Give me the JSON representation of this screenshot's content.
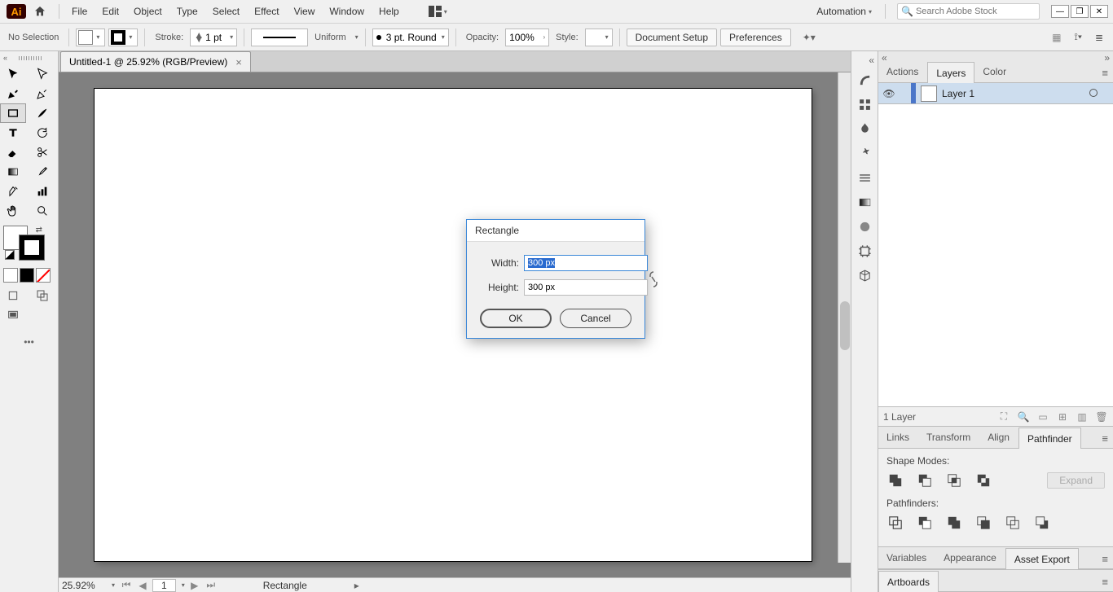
{
  "menu": {
    "items": [
      "File",
      "Edit",
      "Object",
      "Type",
      "Select",
      "Effect",
      "View",
      "Window",
      "Help"
    ]
  },
  "workspace": "Automation",
  "search_placeholder": "Search Adobe Stock",
  "control": {
    "selection": "No Selection",
    "stroke_label": "Stroke:",
    "stroke_weight": "1 pt",
    "brush_label": "Uniform",
    "vw_label": "3 pt. Round",
    "opacity_label": "Opacity:",
    "opacity_value": "100%",
    "style_label": "Style:",
    "doc_setup": "Document Setup",
    "prefs": "Preferences"
  },
  "doc_tab": {
    "title": "Untitled-1 @ 25.92% (RGB/Preview)"
  },
  "dialog": {
    "title": "Rectangle",
    "width_label": "Width:",
    "width_value": "300 px",
    "height_label": "Height:",
    "height_value": "300 px",
    "ok": "OK",
    "cancel": "Cancel"
  },
  "rpanel": {
    "tabs1": [
      "Actions",
      "Layers",
      "Color"
    ],
    "layer_name": "Layer 1",
    "layer_count": "1 Layer",
    "tabs2": [
      "Links",
      "Transform",
      "Align",
      "Pathfinder"
    ],
    "shape_modes": "Shape Modes:",
    "expand": "Expand",
    "pathfinders": "Pathfinders:",
    "tabs3": [
      "Variables",
      "Appearance",
      "Asset Export"
    ],
    "tabs4": [
      "Artboards"
    ]
  },
  "status": {
    "zoom": "25.92%",
    "page": "1",
    "tool": "Rectangle"
  }
}
